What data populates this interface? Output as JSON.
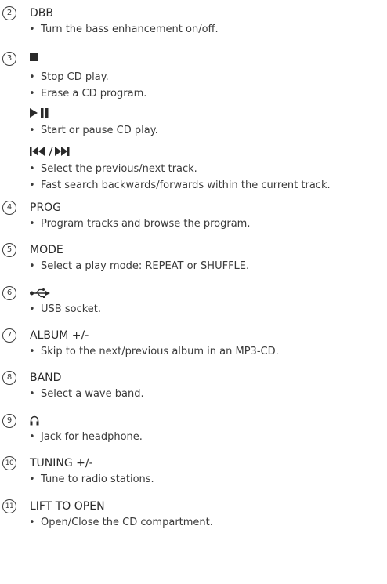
{
  "items": [
    {
      "number": "2",
      "title": "DBB",
      "bullets": [
        "Turn the bass enhancement on/off."
      ]
    },
    {
      "number": "3",
      "icon": "stop-icon",
      "bullets": [
        "Stop CD play.",
        "Erase a CD program."
      ],
      "subs": [
        {
          "icon": "play-pause-icon",
          "bullets": [
            "Start or pause CD play."
          ]
        },
        {
          "icon": "previous-next-icon",
          "bullets": [
            "Select the previous/next track.",
            "Fast search backwards/forwards within the current track."
          ]
        }
      ]
    },
    {
      "number": "4",
      "title": "PROG",
      "bullets": [
        "Program tracks and browse the program."
      ]
    },
    {
      "number": "5",
      "title": "MODE",
      "bullets": [
        "Select a play mode: REPEAT or SHUFFLE."
      ]
    },
    {
      "number": "6",
      "icon": "usb-icon",
      "bullets": [
        "USB socket."
      ]
    },
    {
      "number": "7",
      "title": "ALBUM +/-",
      "bullets": [
        "Skip to the next/previous album in an MP3-CD."
      ]
    },
    {
      "number": "8",
      "title": "BAND",
      "bullets": [
        "Select a wave band."
      ]
    },
    {
      "number": "9",
      "icon": "headphone-icon",
      "bullets": [
        "Jack for headphone."
      ]
    },
    {
      "number": "10",
      "title": "TUNING +/-",
      "bullets": [
        "Tune to radio stations."
      ]
    },
    {
      "number": "11",
      "title": "LIFT TO OPEN",
      "bullets": [
        "Open/Close the CD compartment."
      ]
    }
  ]
}
